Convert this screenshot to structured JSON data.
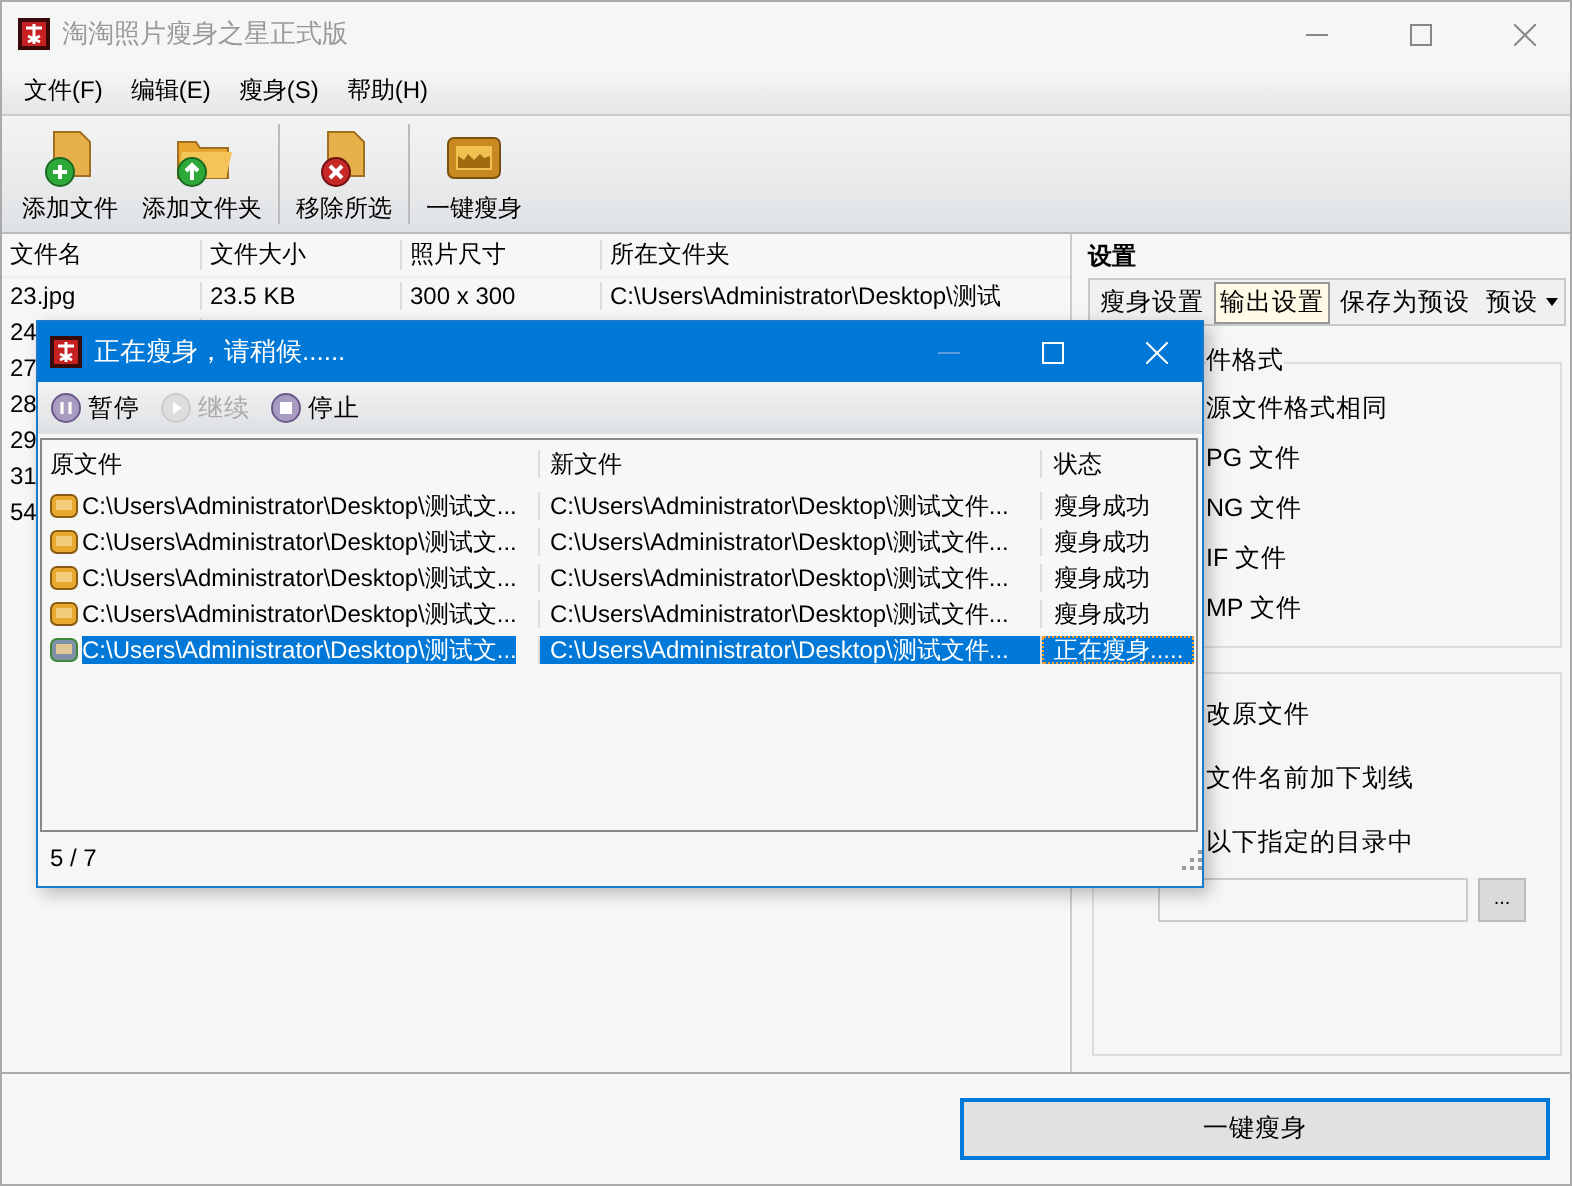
{
  "window": {
    "title": "淘淘照片瘦身之星正式版"
  },
  "menu": [
    "文件(F)",
    "编辑(E)",
    "瘦身(S)",
    "帮助(H)"
  ],
  "toolbar": [
    {
      "label": "添加文件",
      "kind": "add-file"
    },
    {
      "label": "添加文件夹",
      "kind": "add-folder"
    },
    {
      "label": "移除所选",
      "kind": "remove"
    },
    {
      "label": "一键瘦身",
      "kind": "run"
    }
  ],
  "file_list": {
    "columns": [
      "文件名",
      "文件大小",
      "照片尺寸",
      "所在文件夹"
    ],
    "rows": [
      [
        "23.jpg",
        "23.5 KB",
        "300 x 300",
        "C:\\Users\\Administrator\\Desktop\\测试"
      ],
      [
        "24"
      ],
      [
        "27"
      ],
      [
        "28"
      ],
      [
        "29"
      ],
      [
        "31"
      ],
      [
        "54"
      ]
    ]
  },
  "settings": {
    "title": "设置",
    "tabs": [
      {
        "label": "瘦身设置",
        "selected": false,
        "dropdown": false
      },
      {
        "label": "输出设置",
        "selected": true,
        "dropdown": false
      },
      {
        "label": "保存为预设",
        "selected": false,
        "dropdown": false
      },
      {
        "label": "预设",
        "selected": false,
        "dropdown": true
      }
    ],
    "format_group": {
      "title": "件格式",
      "options": [
        "源文件格式相同",
        "PG 文件",
        "NG 文件",
        "IF 文件",
        "MP 文件"
      ]
    },
    "location_group": {
      "options": [
        "改原文件",
        "文件名前加下划线",
        "以下指定的目录中"
      ],
      "browse_button": "..."
    }
  },
  "run_button": "一键瘦身",
  "dialog": {
    "title": "正在瘦身，请稍候......",
    "controls": [
      {
        "label": "暂停",
        "disabled": false
      },
      {
        "label": "继续",
        "disabled": true
      },
      {
        "label": "停止",
        "disabled": false
      }
    ],
    "columns": [
      "原文件",
      "新文件",
      "状态"
    ],
    "rows": [
      {
        "kind": "done",
        "source": "C:\\Users\\Administrator\\Desktop\\测试文...",
        "target": "C:\\Users\\Administrator\\Desktop\\测试文件...",
        "status": "瘦身成功",
        "selected": false
      },
      {
        "kind": "done",
        "source": "C:\\Users\\Administrator\\Desktop\\测试文...",
        "target": "C:\\Users\\Administrator\\Desktop\\测试文件...",
        "status": "瘦身成功",
        "selected": false
      },
      {
        "kind": "done",
        "source": "C:\\Users\\Administrator\\Desktop\\测试文...",
        "target": "C:\\Users\\Administrator\\Desktop\\测试文件...",
        "status": "瘦身成功",
        "selected": false
      },
      {
        "kind": "done",
        "source": "C:\\Users\\Administrator\\Desktop\\测试文...",
        "target": "C:\\Users\\Administrator\\Desktop\\测试文件...",
        "status": "瘦身成功",
        "selected": false
      },
      {
        "kind": "active",
        "source": "C:\\Users\\Administrator\\Desktop\\测试文...",
        "target": "C:\\Users\\Administrator\\Desktop\\测试文件...",
        "status": "正在瘦身.....",
        "selected": true
      }
    ],
    "status_bar": "5 / 7"
  }
}
